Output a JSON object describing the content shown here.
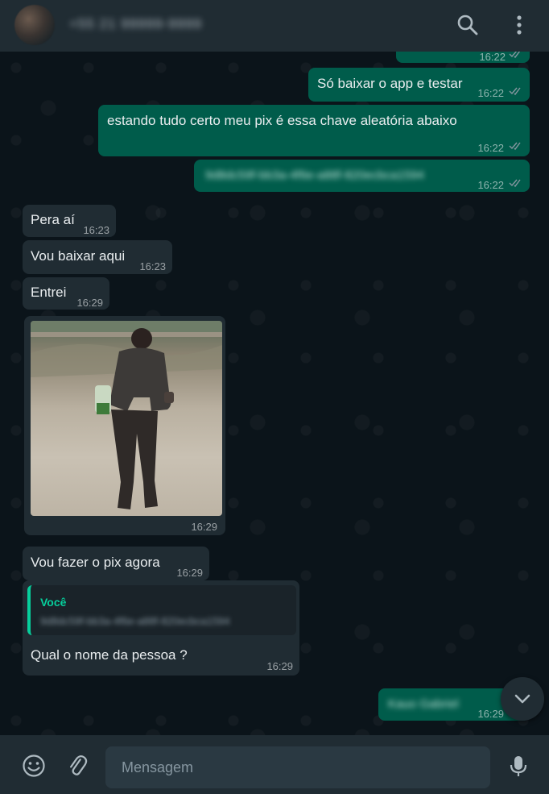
{
  "header": {
    "contact_name": "+55 21 99999-9999",
    "search_icon": "search-icon",
    "menu_icon": "more-vertical-icon"
  },
  "colors": {
    "header_bg": "#202c33",
    "chat_bg": "#0b141a",
    "outgoing_bubble": "#005c4b",
    "incoming_bubble": "#202c33",
    "read_ticks": "#53bdeb",
    "accent": "#06cf9c"
  },
  "messages": [
    {
      "direction": "out",
      "text": "",
      "time": "16:22",
      "status": "read"
    },
    {
      "direction": "out",
      "text": "Só baixar o app e testar",
      "time": "16:22",
      "status": "read"
    },
    {
      "direction": "out",
      "text": "estando tudo certo meu pix é essa chave aleatória abaixo",
      "time": "16:22",
      "status": "read"
    },
    {
      "direction": "out",
      "text": "9d8dc59f-bb3a-4f6e-a88f-820ecbca1594",
      "time": "16:22",
      "status": "read"
    },
    {
      "direction": "in",
      "text": "Pera aí",
      "time": "16:23"
    },
    {
      "direction": "in",
      "text": "Vou baixar aqui",
      "time": "16:23"
    },
    {
      "direction": "in",
      "text": "Entrei",
      "time": "16:29"
    },
    {
      "direction": "in",
      "type": "image",
      "time": "16:29"
    },
    {
      "direction": "in",
      "text": "Vou fazer o pix agora",
      "time": "16:29"
    },
    {
      "direction": "in",
      "text": "Qual o nome da pessoa ?",
      "time": "16:29",
      "quote": {
        "author": "Você",
        "text": "9d8dc59f-bb3a-4f6e-a88f-820ecbca1594"
      }
    },
    {
      "direction": "out",
      "text": "Kauo Gabriel",
      "time": "16:29",
      "status": "read"
    }
  ],
  "footer": {
    "placeholder": "Mensagem",
    "emoji_icon": "emoji-icon",
    "attach_icon": "paperclip-icon",
    "mic_icon": "microphone-icon"
  }
}
